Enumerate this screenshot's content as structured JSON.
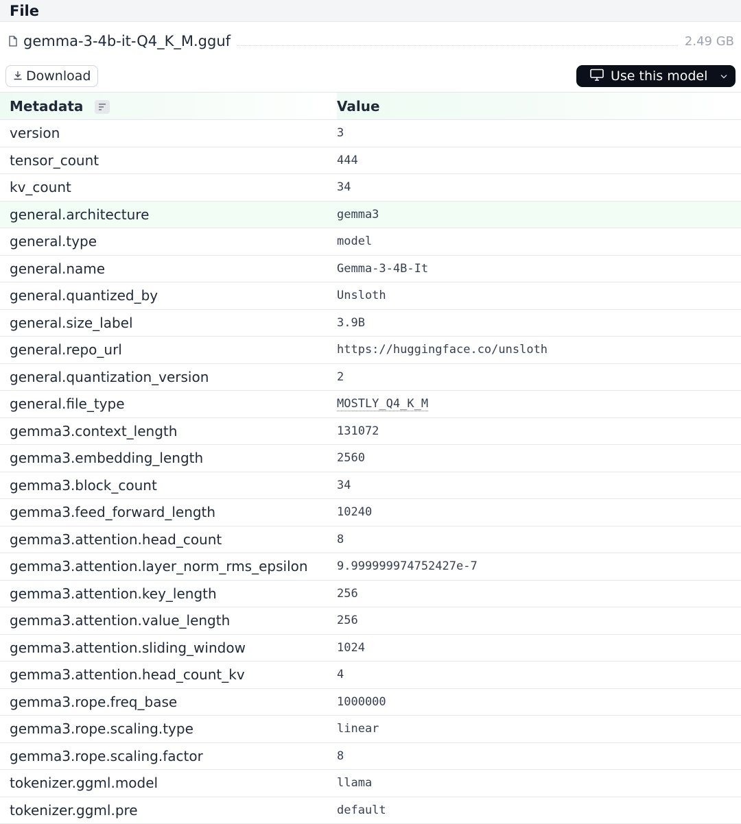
{
  "file_section": {
    "title": "File",
    "file_name": "gemma-3-4b-it-Q4_K_M.gguf",
    "file_size": "2.49 GB",
    "download_label": "Download",
    "use_model_label": "Use this model"
  },
  "table": {
    "header_key": "Metadata",
    "header_value": "Value",
    "rows": [
      {
        "key": "version",
        "value": "3"
      },
      {
        "key": "tensor_count",
        "value": "444"
      },
      {
        "key": "kv_count",
        "value": "34"
      },
      {
        "key": "general.architecture",
        "value": "gemma3"
      },
      {
        "key": "general.type",
        "value": "model"
      },
      {
        "key": "general.name",
        "value": "Gemma-3-4B-It"
      },
      {
        "key": "general.quantized_by",
        "value": "Unsloth"
      },
      {
        "key": "general.size_label",
        "value": "3.9B"
      },
      {
        "key": "general.repo_url",
        "value": "https://huggingface.co/unsloth"
      },
      {
        "key": "general.quantization_version",
        "value": "2"
      },
      {
        "key": "general.file_type",
        "value": "MOSTLY_Q4_K_M"
      },
      {
        "key": "gemma3.context_length",
        "value": "131072"
      },
      {
        "key": "gemma3.embedding_length",
        "value": "2560"
      },
      {
        "key": "gemma3.block_count",
        "value": "34"
      },
      {
        "key": "gemma3.feed_forward_length",
        "value": "10240"
      },
      {
        "key": "gemma3.attention.head_count",
        "value": "8"
      },
      {
        "key": "gemma3.attention.layer_norm_rms_epsilon",
        "value": "9.999999974752427e-7"
      },
      {
        "key": "gemma3.attention.key_length",
        "value": "256"
      },
      {
        "key": "gemma3.attention.value_length",
        "value": "256"
      },
      {
        "key": "gemma3.attention.sliding_window",
        "value": "1024"
      },
      {
        "key": "gemma3.attention.head_count_kv",
        "value": "4"
      },
      {
        "key": "gemma3.rope.freq_base",
        "value": "1000000"
      },
      {
        "key": "gemma3.rope.scaling.type",
        "value": "linear"
      },
      {
        "key": "gemma3.rope.scaling.factor",
        "value": "8"
      },
      {
        "key": "tokenizer.ggml.model",
        "value": "llama"
      },
      {
        "key": "tokenizer.ggml.pre",
        "value": "default"
      }
    ]
  }
}
